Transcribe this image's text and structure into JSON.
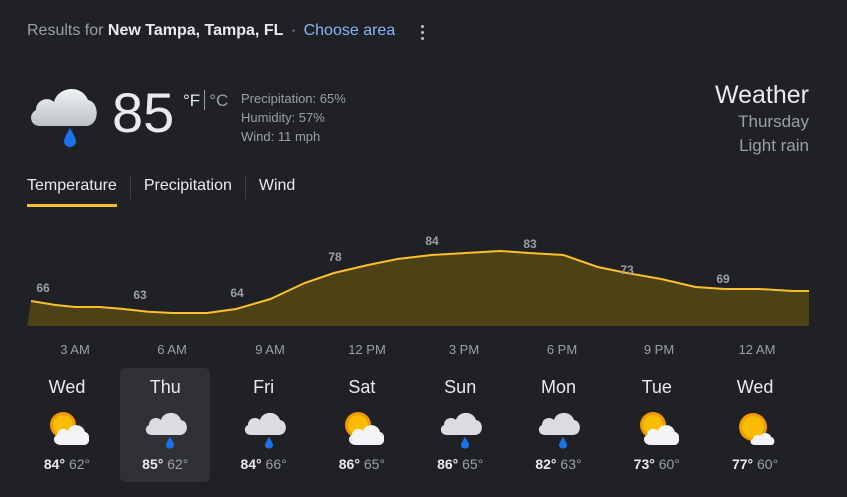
{
  "header": {
    "results_prefix": "Results for",
    "location": "New Tampa, Tampa, FL",
    "separator": "·",
    "choose_area": "Choose area"
  },
  "current": {
    "temperature": "85",
    "unit_f": "°F",
    "unit_c": "°C",
    "precipitation": "Precipitation: 65%",
    "humidity": "Humidity: 57%",
    "wind": "Wind: 11 mph",
    "icon": "light-rain-icon"
  },
  "title": {
    "label": "Weather",
    "day": "Thursday",
    "condition": "Light rain"
  },
  "tabs": [
    {
      "label": "Temperature",
      "active": true
    },
    {
      "label": "Precipitation",
      "active": false
    },
    {
      "label": "Wind",
      "active": false
    }
  ],
  "chart_data": {
    "type": "area",
    "title": "",
    "xlabel": "",
    "ylabel": "",
    "color": "#fbc02d",
    "fill": "#4d4116",
    "categories": [
      "3 AM",
      "6 AM",
      "9 AM",
      "12 PM",
      "3 PM",
      "6 PM",
      "9 PM",
      "12 AM"
    ],
    "labeled_points": [
      {
        "x": 0,
        "value": 66
      },
      {
        "x": 1,
        "value": 63
      },
      {
        "x": 2,
        "value": 64
      },
      {
        "x": 3,
        "value": 78
      },
      {
        "x": 4,
        "value": 84
      },
      {
        "x": 5,
        "value": 83
      },
      {
        "x": 6,
        "value": 73
      },
      {
        "x": 7,
        "value": 69
      }
    ],
    "curve": [
      [
        -0.45,
        66
      ],
      [
        -0.2,
        65
      ],
      [
        0,
        64.5
      ],
      [
        0.25,
        64.5
      ],
      [
        0.5,
        64
      ],
      [
        0.75,
        63.3
      ],
      [
        1,
        63
      ],
      [
        1.35,
        63
      ],
      [
        1.65,
        64
      ],
      [
        2,
        66.5
      ],
      [
        2.35,
        70.5
      ],
      [
        2.65,
        73
      ],
      [
        3,
        75
      ],
      [
        3.3,
        76.5
      ],
      [
        3.65,
        77.5
      ],
      [
        4,
        78
      ],
      [
        4.35,
        78.5
      ],
      [
        4.65,
        78
      ],
      [
        5,
        77.5
      ],
      [
        5.35,
        74.5
      ],
      [
        5.65,
        73
      ],
      [
        6,
        71.5
      ],
      [
        6.35,
        69.5
      ],
      [
        6.65,
        69
      ],
      [
        7,
        69
      ],
      [
        7.35,
        68.5
      ],
      [
        7.9,
        68.5
      ]
    ],
    "ylim": [
      55,
      90
    ],
    "grid": false,
    "legend": "none"
  },
  "forecast": [
    {
      "day": "Wed",
      "hi": "84°",
      "lo": "62°",
      "icon": "partly-cloudy-icon",
      "selected": false
    },
    {
      "day": "Thu",
      "hi": "85°",
      "lo": "62°",
      "icon": "light-rain-icon",
      "selected": true
    },
    {
      "day": "Fri",
      "hi": "84°",
      "lo": "66°",
      "icon": "light-rain-icon",
      "selected": false
    },
    {
      "day": "Sat",
      "hi": "86°",
      "lo": "65°",
      "icon": "partly-cloudy-icon",
      "selected": false
    },
    {
      "day": "Sun",
      "hi": "86°",
      "lo": "65°",
      "icon": "light-rain-icon",
      "selected": false
    },
    {
      "day": "Mon",
      "hi": "82°",
      "lo": "63°",
      "icon": "light-rain-icon",
      "selected": false
    },
    {
      "day": "Tue",
      "hi": "73°",
      "lo": "60°",
      "icon": "partly-cloudy-icon",
      "selected": false
    },
    {
      "day": "Wed",
      "hi": "77°",
      "lo": "60°",
      "icon": "mostly-sunny-icon",
      "selected": false
    }
  ]
}
